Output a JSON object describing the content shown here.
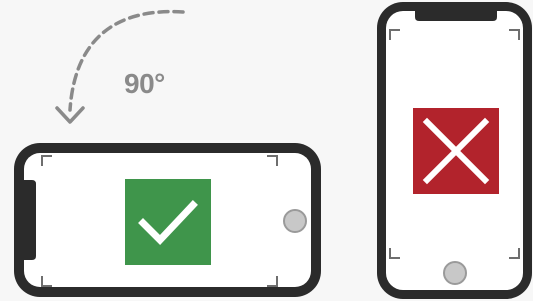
{
  "rotation": {
    "label": "90°"
  },
  "colors": {
    "background": "#f7f7f7",
    "phone_frame": "#2b2b2b",
    "screen": "#ffffff",
    "corner_marks": "#6e6e6e",
    "arrow": "#8a8a8a",
    "label": "#8a8a8a",
    "valid": "#3f954b",
    "invalid": "#b2232c",
    "home_button_fill": "#c8c8c8",
    "home_button_ring": "#9a9a9a"
  },
  "landscape_phone": {
    "status": "valid",
    "icon": "checkmark-icon"
  },
  "portrait_phone": {
    "status": "invalid",
    "icon": "cross-icon"
  }
}
